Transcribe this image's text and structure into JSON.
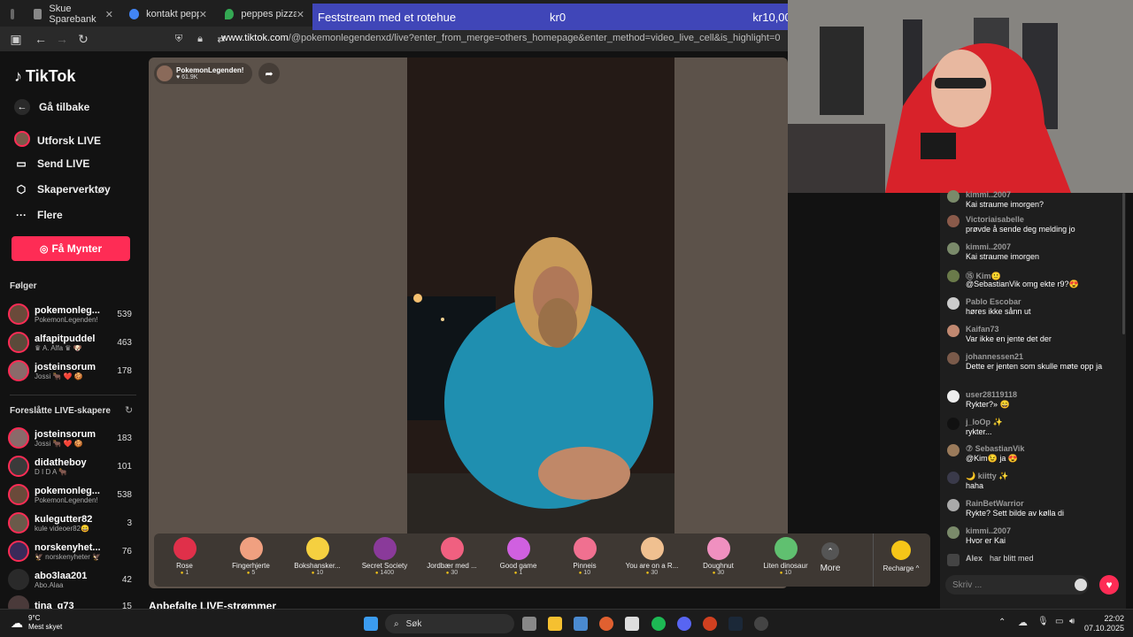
{
  "browser": {
    "tabs": [
      {
        "label": "Skue Sparebank",
        "color": "#888888"
      },
      {
        "label": "kontakt peppes bes",
        "color": "#4285f4"
      },
      {
        "label": "peppes pizza - Goo",
        "color": "#34a853"
      }
    ],
    "url_host": "www.tiktok.com",
    "url_path": "/@pokemonlegendenxd/live?enter_from_merge=others_homepage&enter_method=video_live_cell&is_highlight=0"
  },
  "banner": {
    "title": "Feststream med et rotehue",
    "current": "kr0",
    "goal": "kr10,000"
  },
  "sidebar": {
    "logo": "TikTok",
    "back": "Gå tilbake",
    "nav": [
      {
        "label": "Utforsk LIVE",
        "icon": "live-explore-icon"
      },
      {
        "label": "Send LIVE",
        "icon": "video-camera-icon"
      },
      {
        "label": "Skaperverktøy",
        "icon": "creator-tools-icon"
      },
      {
        "label": "Flere",
        "icon": "more-icon"
      }
    ],
    "coins_button": "Få Mynter",
    "following_title": "Følger",
    "following": [
      {
        "name": "pokemonleg...",
        "sub": "PokemonLegenden!",
        "count": "539"
      },
      {
        "name": "alfapitpuddel",
        "sub": "♛ A. Alfa ♛ 🐶",
        "count": "463"
      },
      {
        "name": "josteinsorum",
        "sub": "Jossi 🐂 ❤️ 🍪",
        "count": "178"
      }
    ],
    "suggested_title": "Foreslåtte LIVE-skapere",
    "suggested": [
      {
        "name": "josteinsorum",
        "sub": "Jossi 🐂 ❤️ 🍪",
        "count": "183"
      },
      {
        "name": "didatheboy",
        "sub": "D I D A 🐂",
        "count": "101"
      },
      {
        "name": "pokemonleg...",
        "sub": "PokemonLegenden!",
        "count": "538"
      },
      {
        "name": "kulegutter82",
        "sub": "kule videoer82😄",
        "count": "3"
      },
      {
        "name": "norskenyhet...",
        "sub": "🦅 norskenyheter 🦅",
        "count": "76"
      },
      {
        "name": "abo3laa201",
        "sub": "Abo.Alaa",
        "count": "42"
      },
      {
        "name": "tina_g73",
        "sub": "",
        "count": "15"
      }
    ]
  },
  "stream": {
    "host_name": "PokemonLegenden!",
    "host_viewers": "♥ 61.9K",
    "recommended_title": "Anbefalte LIVE-strømmer"
  },
  "gifts": [
    {
      "name": "Rose",
      "price": "1",
      "color": "#e0304a"
    },
    {
      "name": "Fingerhjerte",
      "price": "5",
      "color": "#f0a080"
    },
    {
      "name": "Bokshansker...",
      "price": "10",
      "color": "#f5d040"
    },
    {
      "name": "Secret Society",
      "price": "1400",
      "color": "#8a3a9a"
    },
    {
      "name": "Jordbær med ...",
      "price": "30",
      "color": "#f06080"
    },
    {
      "name": "Good game",
      "price": "1",
      "color": "#d060e0"
    },
    {
      "name": "Pinneis",
      "price": "10",
      "color": "#f07090"
    },
    {
      "name": "You are on a R...",
      "price": "30",
      "color": "#f0c090"
    },
    {
      "name": "Doughnut",
      "price": "30",
      "color": "#f090c0"
    },
    {
      "name": "Liten dinosaur",
      "price": "10",
      "color": "#60c070"
    }
  ],
  "gift_more": "More",
  "recharge": "Recharge ^",
  "chat": {
    "messages": [
      {
        "user": "kimmi..2007",
        "text": "Kai straume imorgen?"
      },
      {
        "user": "Victoriaisabelle",
        "text": "prøvde å sende deg melding jo"
      },
      {
        "user": "kimmi..2007",
        "text": "Kai straume imorgen"
      },
      {
        "user": "⑮ Kim🙂",
        "text": "@SebastianVik omg ekte r9?😍"
      },
      {
        "user": "Pablo Escobar",
        "text": "høres ikke sånn ut"
      },
      {
        "user": "Kaifan73",
        "text": "Var ikke en jente det der"
      },
      {
        "user": "johannessen21",
        "text": "Dette er jenten som skulle møte opp ja"
      },
      {
        "user": "user28119118",
        "text": "Rykter?» 😄"
      },
      {
        "user": "j_loOp ✨",
        "text": "rykter..."
      },
      {
        "user": "⑦ SebastianVik",
        "text": "@Kim😉 ja 😍"
      },
      {
        "user": "🌙 kiitty ✨",
        "text": "haha"
      },
      {
        "user": "RainBetWarrior",
        "text": "Rykte? Sett bilde av kølla di"
      },
      {
        "user": "kimmi..2007",
        "text": "Hvor er Kai"
      },
      {
        "user": "Alex",
        "text": "har blitt med"
      }
    ],
    "input_placeholder": "Skriv ..."
  },
  "taskbar": {
    "weather_temp": "9°C",
    "weather_desc": "Mest skyet",
    "search": "Søk",
    "time": "22:02",
    "date": "07.10.2025"
  }
}
